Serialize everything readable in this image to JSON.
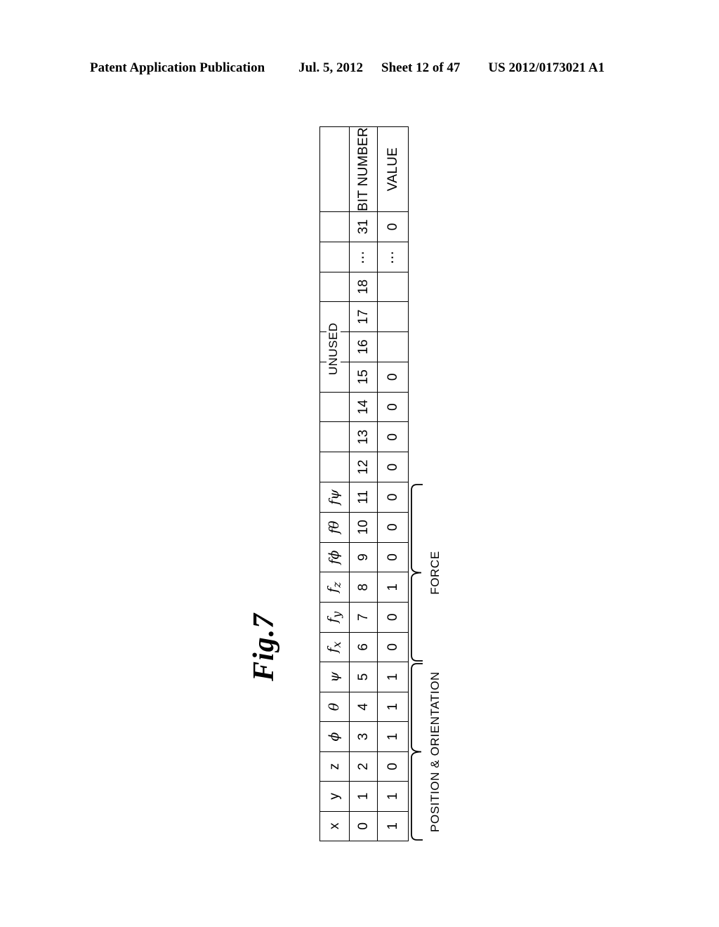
{
  "header": {
    "publication": "Patent Application Publication",
    "date": "Jul. 5, 2012",
    "sheet": "Sheet 12 of 47",
    "pub_number": "US 2012/0173021 A1"
  },
  "figure": {
    "label": "Fig.7",
    "row_headers": {
      "bit_number": "BIT NUMBER",
      "value": "VALUE"
    },
    "unused_label": "UNUSED",
    "ellipsis": "⋯",
    "groups": [
      {
        "name": "position-orientation",
        "label": "POSITION & ORIENTATION",
        "first_bit": 0,
        "last_bit": 5
      },
      {
        "name": "force",
        "label": "FORCE",
        "first_bit": 6,
        "last_bit": 11
      }
    ],
    "columns": [
      {
        "field": "x",
        "field_html": "x",
        "bit": "0",
        "value": "1"
      },
      {
        "field": "y",
        "field_html": "y",
        "bit": "1",
        "value": "1"
      },
      {
        "field": "z",
        "field_html": "z",
        "bit": "2",
        "value": "0"
      },
      {
        "field": "ϕ",
        "field_html": "ϕ",
        "bit": "3",
        "value": "1"
      },
      {
        "field": "θ",
        "field_html": "θ",
        "bit": "4",
        "value": "1"
      },
      {
        "field": "ψ",
        "field_html": "ψ",
        "bit": "5",
        "value": "1"
      },
      {
        "field": "fx",
        "field_html": "f<sub>x</sub>",
        "bit": "6",
        "value": "0"
      },
      {
        "field": "fy",
        "field_html": "f<sub>y</sub>",
        "bit": "7",
        "value": "0"
      },
      {
        "field": "fz",
        "field_html": "f<sub>z</sub>",
        "bit": "8",
        "value": "1"
      },
      {
        "field": "fϕ",
        "field_html": "fϕ",
        "bit": "9",
        "value": "0"
      },
      {
        "field": "fθ",
        "field_html": "fθ",
        "bit": "10",
        "value": "0"
      },
      {
        "field": "fψ",
        "field_html": "fψ",
        "bit": "11",
        "value": "0"
      },
      {
        "field": "",
        "field_html": "",
        "bit": "12",
        "value": "0"
      },
      {
        "field": "",
        "field_html": "",
        "bit": "13",
        "value": "0"
      },
      {
        "field": "",
        "field_html": "",
        "bit": "14",
        "value": "0"
      },
      {
        "field": "",
        "field_html": "",
        "bit": "15",
        "value": "0"
      },
      {
        "field": "",
        "field_html": "",
        "bit": "16",
        "value": ""
      },
      {
        "field": "",
        "field_html": "",
        "bit": "17",
        "value": ""
      },
      {
        "field": "",
        "field_html": "",
        "bit": "18",
        "value": ""
      },
      {
        "field": "",
        "field_html": "",
        "bit": "⋯",
        "value": "⋯"
      },
      {
        "field": "",
        "field_html": "",
        "bit": "31",
        "value": "0"
      }
    ]
  }
}
